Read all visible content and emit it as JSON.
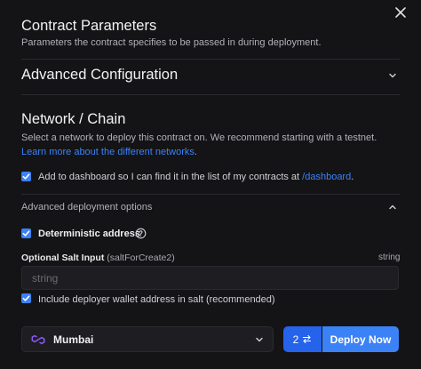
{
  "contract_parameters": {
    "title": "Contract Parameters",
    "subtitle": "Parameters the contract specifies to be passed in during deployment."
  },
  "advanced_configuration": {
    "title": "Advanced Configuration"
  },
  "network_chain": {
    "title": "Network / Chain",
    "desc_line1": "Select a network to deploy this contract on. We recommend starting with a testnet.",
    "link_part1": "Learn",
    "link_part2": "more about the different networks",
    "desc_end": "."
  },
  "dashboard_checkbox": {
    "label": "Add to dashboard so I can find it in the list of my contracts at",
    "link": "/dashboard",
    "end": ".",
    "checked": true
  },
  "advanced_deployment": {
    "title": "Advanced deployment options"
  },
  "deterministic": {
    "label": "Deterministic address",
    "checked": true
  },
  "salt": {
    "label": "Optional Salt Input",
    "param": "(saltForCreate2)",
    "type": "string",
    "placeholder": "string"
  },
  "include_wallet": {
    "label": "Include deployer wallet address in salt (recommended)",
    "checked": true
  },
  "network_select": {
    "selected": "Mumbai"
  },
  "deploy": {
    "count": "2",
    "count_icon": "swap-arrows-icon",
    "label": "Deploy Now"
  },
  "colors": {
    "accent": "#3b82f6",
    "background": "#141417"
  }
}
